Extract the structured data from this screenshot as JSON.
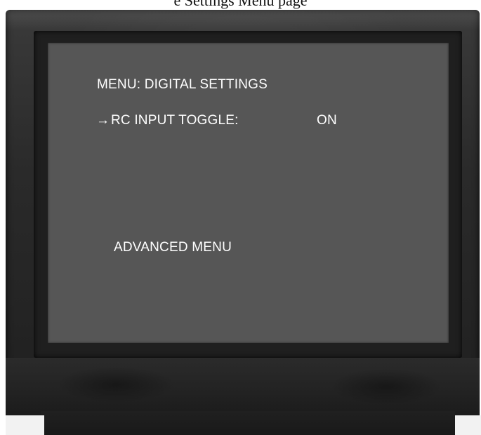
{
  "caption": {
    "partial_text": "e Settings Menu page"
  },
  "screen": {
    "background_color": "#565656",
    "text_color": "#ffffff",
    "menu_title": "MENU: DIGITAL SETTINGS",
    "items": [
      {
        "selector_icon": "→",
        "label": "RC INPUT TOGGLE:",
        "value": "ON",
        "selected": true
      }
    ],
    "advanced_menu_label": "ADVANCED MENU"
  },
  "device": {
    "type": "television",
    "body_color": "#2a2a2a"
  }
}
